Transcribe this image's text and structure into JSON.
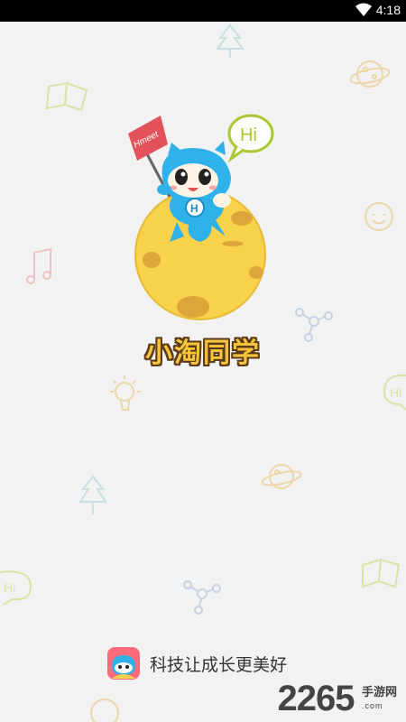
{
  "status_bar": {
    "time": "4:18"
  },
  "app": {
    "name": "小淘同学",
    "slogan": "科技让成长更美好"
  },
  "mascot": {
    "flag_text": "Hmeet",
    "speech_text": "Hi",
    "badge_letter": "H"
  },
  "doodles": {
    "hi_text": "Hi"
  },
  "watermark": {
    "number": "2265",
    "text": "手游网",
    "sub": ".com"
  },
  "colors": {
    "moon": "#f8d24a",
    "mascot_blue": "#2fb1ea",
    "doodle_green": "#c9dd6a",
    "doodle_teal": "#a6d6d3"
  }
}
